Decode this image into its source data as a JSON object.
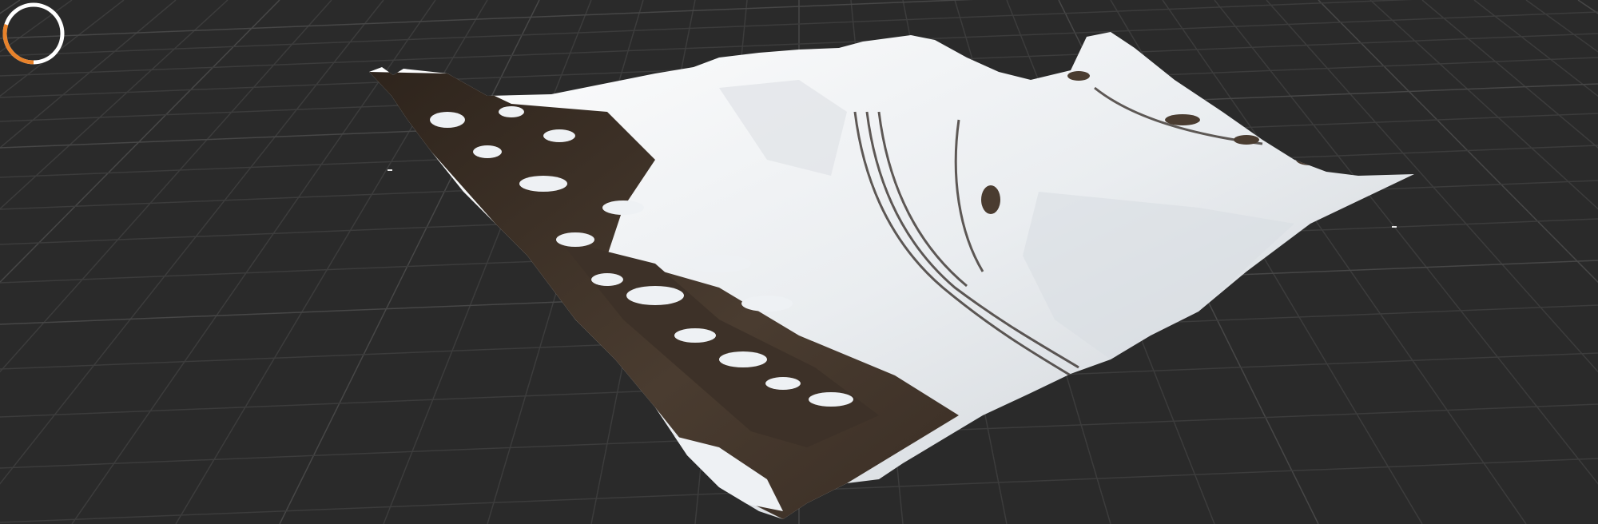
{
  "viewport": {
    "background": "#2a2a2a",
    "grid_color": "#3c3c3c",
    "grid_major_color": "#474747"
  },
  "terrain": {
    "name": "snow-mountain",
    "snow_color": "#eef1f4",
    "rock_color": "#4a3c30",
    "rock_dark_color": "#2b221b"
  },
  "loading_indicator": {
    "icon": "loading-ring-icon",
    "track_color": "#ffffff",
    "progress_color": "#e8822a",
    "progress_fraction": 0.3
  }
}
